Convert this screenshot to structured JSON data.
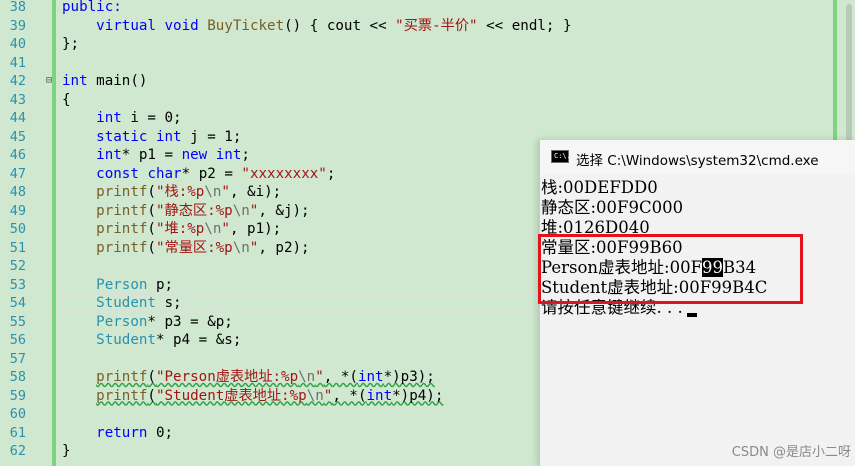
{
  "editor": {
    "lines": [
      {
        "n": "38"
      },
      {
        "n": "39"
      },
      {
        "n": "40"
      },
      {
        "n": "41"
      },
      {
        "n": "42"
      },
      {
        "n": "43"
      },
      {
        "n": "44"
      },
      {
        "n": "45"
      },
      {
        "n": "46"
      },
      {
        "n": "47"
      },
      {
        "n": "48"
      },
      {
        "n": "49"
      },
      {
        "n": "50"
      },
      {
        "n": "51"
      },
      {
        "n": "52"
      },
      {
        "n": "53"
      },
      {
        "n": "54"
      },
      {
        "n": "55"
      },
      {
        "n": "56"
      },
      {
        "n": "57"
      },
      {
        "n": "58"
      },
      {
        "n": "59"
      },
      {
        "n": "60"
      },
      {
        "n": "61"
      },
      {
        "n": "62"
      }
    ],
    "code": {
      "l38": {
        "a": "public:"
      },
      "l39": {
        "kw1": "virtual",
        "kw2": "void",
        "fn": "BuyTicket",
        "rest1": "() { ",
        "id": "cout",
        "op1": " << ",
        "str": "\"买票-半价\"",
        "op2": " << ",
        "id2": "endl",
        "rest2": "; }"
      },
      "l40": {
        "a": "};"
      },
      "l42": {
        "kw": "int",
        "rest": " main()"
      },
      "l43": {
        "a": "{"
      },
      "l44": {
        "kw": "int",
        "rest": " i = 0;"
      },
      "l45": {
        "kw1": "static",
        "kw2": "int",
        "rest": " j = 1;"
      },
      "l46": {
        "kw": "int",
        "rest1": "* p1 = ",
        "kw2": "new",
        "kw3": "int",
        "rest2": ";"
      },
      "l47": {
        "kw1": "const",
        "kw2": "char",
        "rest1": "* p2 = ",
        "str": "\"xxxxxxxx\"",
        "rest2": ";"
      },
      "l48": {
        "fn": "printf",
        "p1": "(",
        "s1": "\"栈:%p",
        "esc": "\\n",
        "s2": "\"",
        "rest": ", &i);"
      },
      "l49": {
        "fn": "printf",
        "p1": "(",
        "s1": "\"静态区:%p",
        "esc": "\\n",
        "s2": "\"",
        "rest": ", &j);"
      },
      "l50": {
        "fn": "printf",
        "p1": "(",
        "s1": "\"堆:%p",
        "esc": "\\n",
        "s2": "\"",
        "rest": ", p1);"
      },
      "l51": {
        "fn": "printf",
        "p1": "(",
        "s1": "\"常量区:%p",
        "esc": "\\n",
        "s2": "\"",
        "rest": ", p2);"
      },
      "l53": {
        "t": "Person",
        "rest": " p;"
      },
      "l54": {
        "t": "Student",
        "rest": " s;"
      },
      "l55": {
        "t": "Person",
        "rest": "* p3 = &p;"
      },
      "l56": {
        "t": "Student",
        "rest": "* p4 = &s;"
      },
      "l58": {
        "fn": "printf",
        "p1": "(",
        "s1": "\"Person虚表地址:%p",
        "esc": "\\n",
        "s2": "\"",
        "r1": ", *(",
        "kw": "int",
        "r2": "*)p3);"
      },
      "l59": {
        "fn": "printf",
        "p1": "(",
        "s1": "\"Student虚表地址:%p",
        "esc": "\\n",
        "s2": "\"",
        "r1": ", *(",
        "kw": "int",
        "r2": "*)p4);"
      },
      "l61": {
        "kw": "return",
        "rest": " 0;"
      },
      "l62": {
        "a": "}"
      }
    }
  },
  "console": {
    "title": "选择 C:\\Windows\\system32\\cmd.exe",
    "icon_text": "C:\\.",
    "output": {
      "l1": "栈:00DEFDD0",
      "l2": "静态区:00F9C000",
      "l3": "堆:0126D040",
      "l4": "常量区:00F99B60",
      "l5a": "Person虚表地址:00F",
      "l5b": "99",
      "l5c": "B34",
      "l6": "Student虚表地址:00F99B4C",
      "l7": "请按任意键继续. . ."
    }
  },
  "watermark": "CSDN @是店小二呀",
  "colors": {
    "highlight_box": "#e2131a",
    "background": "#cfe8cf",
    "keyword": "#0000ff",
    "string": "#a31515"
  }
}
